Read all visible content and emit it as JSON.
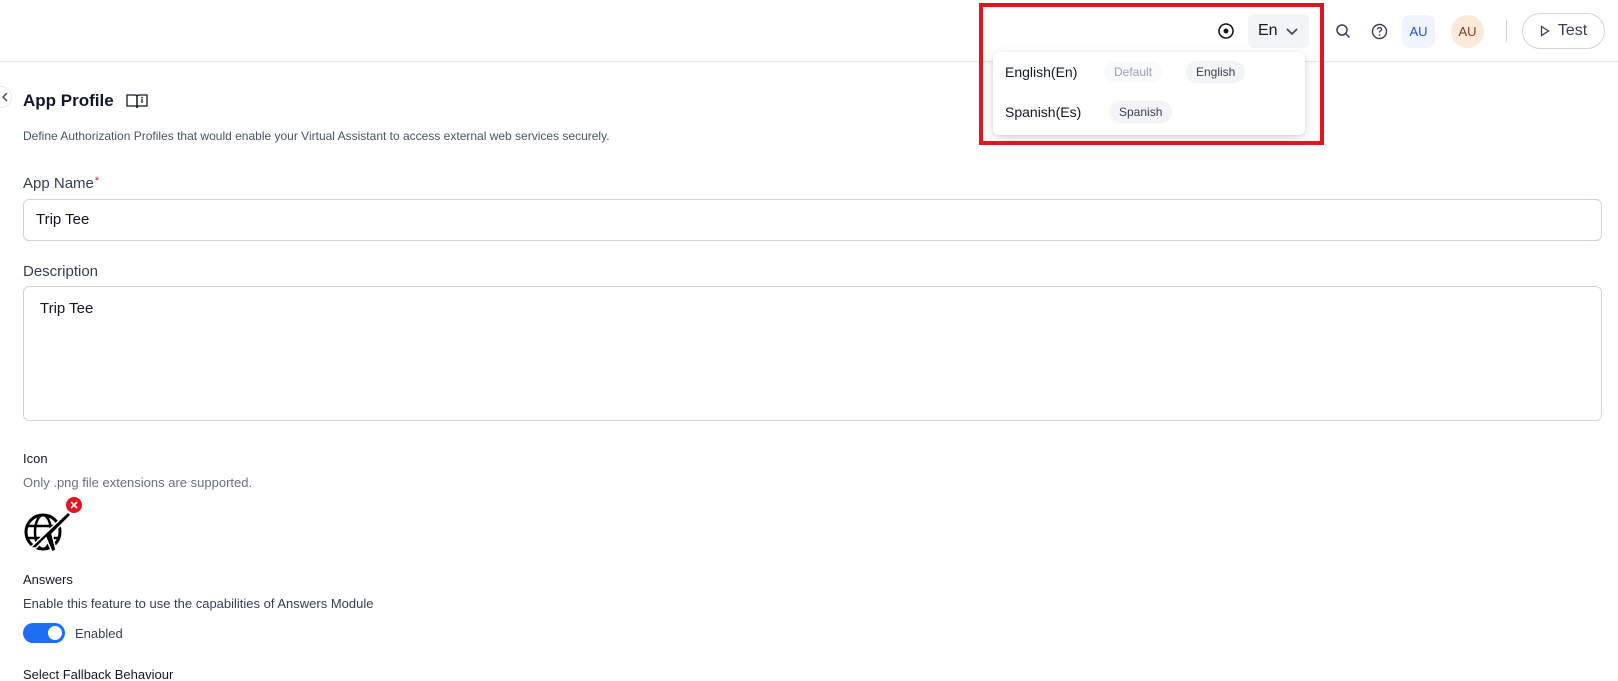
{
  "header": {
    "language_selected": "En",
    "avatars": [
      "AU",
      "AU"
    ],
    "test_label": "Test"
  },
  "language_dropdown": {
    "options": [
      {
        "name": "English(En)",
        "default_tag": "Default",
        "tag": "English"
      },
      {
        "name": "Spanish(Es)",
        "tag": "Spanish"
      }
    ]
  },
  "page": {
    "title": "App Profile",
    "subtitle": "Define Authorization Profiles that would enable your Virtual Assistant to access external web services securely."
  },
  "form": {
    "app_name_label": "App Name",
    "app_name_required": "*",
    "app_name_value": "Trip Tee",
    "description_label": "Description",
    "description_value": "Trip Tee",
    "icon_label": "Icon",
    "icon_hint": "Only .png file extensions are supported.",
    "answers_label": "Answers",
    "answers_hint": "Enable this feature to use the capabilities of Answers Module",
    "answers_toggle_label": "Enabled",
    "answers_enabled": true,
    "fallback_label": "Select Fallback Behaviour"
  },
  "colors": {
    "accent": "#1d6ef2",
    "highlight": "#e2151e"
  }
}
